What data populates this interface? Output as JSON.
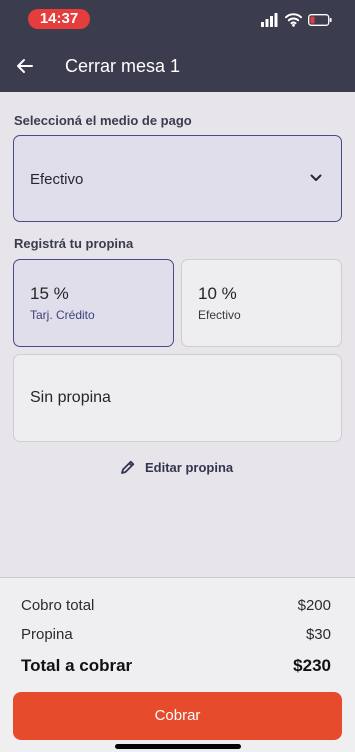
{
  "status_bar": {
    "time": "14:37",
    "signal_icon": "cellular-signal-icon",
    "wifi_icon": "wifi-icon",
    "battery_icon": "battery-low-icon",
    "battery_level_color": "#e43d3b"
  },
  "header": {
    "back_icon": "arrow-left-icon",
    "title": "Cerrar mesa 1"
  },
  "payment": {
    "label": "Seleccioná el medio de pago",
    "selected": "Efectivo",
    "dropdown_icon": "chevron-down-icon"
  },
  "tip": {
    "label": "Registrá tu propina",
    "options": [
      {
        "percent": "15 %",
        "method": "Tarj. Crédito",
        "selected": true
      },
      {
        "percent": "10 %",
        "method": "Efectivo",
        "selected": false
      }
    ],
    "no_tip": "Sin propina",
    "edit_icon": "pencil-icon",
    "edit_label": "Editar propina"
  },
  "summary": {
    "rows": [
      {
        "label": "Cobro total",
        "value": "$200"
      },
      {
        "label": "Propina",
        "value": "$30"
      },
      {
        "label": "Total a cobrar",
        "value": "$230"
      }
    ],
    "button_label": "Cobrar"
  },
  "colors": {
    "header_background": "#3b3c4d",
    "selected_fill": "#dfdeea",
    "selected_border": "#4a4a8a",
    "primary_button": "#e64b2b"
  }
}
